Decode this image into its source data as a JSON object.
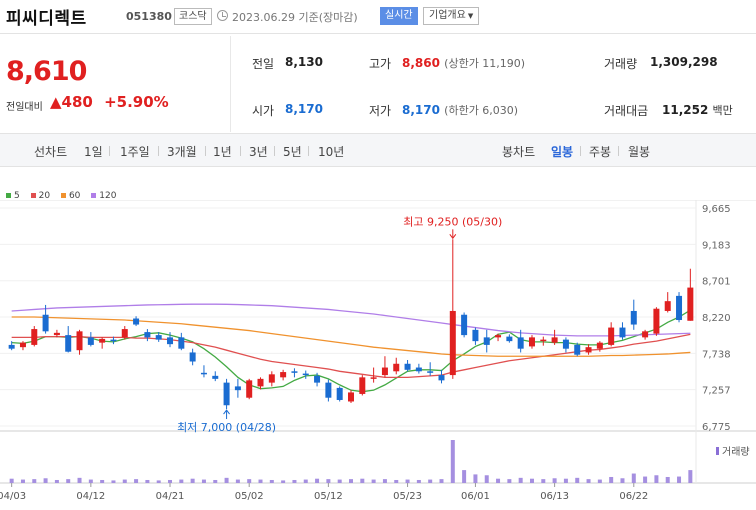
{
  "header": {
    "name": "피씨디렉트",
    "code": "051380",
    "market": "코스닥",
    "datetime": "2023.06.29 기준(장마감)",
    "realtime": "실시간",
    "company_info": "기업개요"
  },
  "price": {
    "current": "8,610",
    "change_label": "전일대비",
    "change_amount": "▲480",
    "change_pct": "+5.90%",
    "color_up": "#e02020",
    "color_down": "#1a6cd1"
  },
  "stats": {
    "prev_close": {
      "label": "전일",
      "value": "8,130"
    },
    "high": {
      "label": "고가",
      "value": "8,860",
      "sub": "(상한가 11,190)"
    },
    "volume": {
      "label": "거래량",
      "value": "1,309,298"
    },
    "open": {
      "label": "시가",
      "value": "8,170"
    },
    "low": {
      "label": "저가",
      "value": "8,170",
      "sub": "(하한가 6,030)"
    },
    "trade_value": {
      "label": "거래대금",
      "value": "11,252",
      "unit": "백만"
    }
  },
  "toolbar": {
    "line_chart": "선차트",
    "periods": [
      "1일",
      "1주일",
      "3개월",
      "1년",
      "3년",
      "5년",
      "10년"
    ],
    "candle_chart": "봉차트",
    "candle_types": [
      "일봉",
      "주봉",
      "월봉"
    ],
    "active_candle": "일봉"
  },
  "chart_data": {
    "type": "candlestick",
    "ma_legend": [
      {
        "name": "5",
        "color": "#44aa44"
      },
      {
        "name": "20",
        "color": "#e05050"
      },
      {
        "name": "60",
        "color": "#f0922e"
      },
      {
        "name": "120",
        "color": "#b07ee8"
      }
    ],
    "y_ticks": [
      "9,665",
      "9,183",
      "8,701",
      "8,220",
      "7,738",
      "7,257",
      "6,775"
    ],
    "ylim": [
      6775,
      9665
    ],
    "x_ticks": [
      "04/03",
      "04/12",
      "04/21",
      "05/02",
      "05/12",
      "05/23",
      "06/01",
      "06/13",
      "06/22"
    ],
    "high_annotation": "최고 9,250 (05/30)",
    "low_annotation": "최저 7,000 (04/28)",
    "volume_label": "거래량",
    "up_color": "#e02020",
    "down_color": "#1a6cd1",
    "candles": [
      {
        "date": "04/03",
        "o": 7850,
        "h": 7900,
        "l": 7780,
        "c": 7800
      },
      {
        "date": "04/04",
        "o": 7820,
        "h": 7900,
        "l": 7780,
        "c": 7880
      },
      {
        "date": "04/05",
        "o": 7850,
        "h": 8100,
        "l": 7830,
        "c": 8060
      },
      {
        "date": "04/06",
        "o": 8250,
        "h": 8380,
        "l": 8000,
        "c": 8030
      },
      {
        "date": "04/07",
        "o": 7980,
        "h": 8050,
        "l": 7950,
        "c": 8010
      },
      {
        "date": "04/10",
        "o": 7980,
        "h": 8100,
        "l": 7750,
        "c": 7760
      },
      {
        "date": "04/11",
        "o": 7780,
        "h": 8050,
        "l": 7720,
        "c": 8030
      },
      {
        "date": "04/12",
        "o": 7950,
        "h": 8020,
        "l": 7830,
        "c": 7850
      },
      {
        "date": "04/13",
        "o": 7880,
        "h": 7950,
        "l": 7800,
        "c": 7930
      },
      {
        "date": "04/14",
        "o": 7920,
        "h": 7960,
        "l": 7860,
        "c": 7900
      },
      {
        "date": "04/17",
        "o": 7950,
        "h": 8100,
        "l": 7920,
        "c": 8060
      },
      {
        "date": "04/18",
        "o": 8200,
        "h": 8230,
        "l": 8100,
        "c": 8120
      },
      {
        "date": "04/19",
        "o": 8020,
        "h": 8060,
        "l": 7900,
        "c": 7950
      },
      {
        "date": "04/20",
        "o": 7980,
        "h": 8020,
        "l": 7890,
        "c": 7920
      },
      {
        "date": "04/21",
        "o": 7950,
        "h": 8020,
        "l": 7820,
        "c": 7860
      },
      {
        "date": "04/24",
        "o": 7950,
        "h": 8010,
        "l": 7780,
        "c": 7800
      },
      {
        "date": "04/25",
        "o": 7750,
        "h": 7800,
        "l": 7580,
        "c": 7630
      },
      {
        "date": "04/26",
        "o": 7480,
        "h": 7580,
        "l": 7420,
        "c": 7460
      },
      {
        "date": "04/27",
        "o": 7440,
        "h": 7500,
        "l": 7370,
        "c": 7400
      },
      {
        "date": "04/28",
        "o": 7350,
        "h": 7400,
        "l": 7000,
        "c": 7050
      },
      {
        "date": "05/01",
        "o": 7300,
        "h": 7400,
        "l": 7150,
        "c": 7250
      },
      {
        "date": "05/02",
        "o": 7150,
        "h": 7400,
        "l": 7130,
        "c": 7380
      },
      {
        "date": "05/03",
        "o": 7300,
        "h": 7420,
        "l": 7260,
        "c": 7400
      },
      {
        "date": "05/04",
        "o": 7350,
        "h": 7500,
        "l": 7300,
        "c": 7460
      },
      {
        "date": "05/08",
        "o": 7420,
        "h": 7520,
        "l": 7380,
        "c": 7490
      },
      {
        "date": "05/09",
        "o": 7500,
        "h": 7540,
        "l": 7420,
        "c": 7480
      },
      {
        "date": "05/10",
        "o": 7470,
        "h": 7510,
        "l": 7400,
        "c": 7450
      },
      {
        "date": "05/11",
        "o": 7440,
        "h": 7480,
        "l": 7300,
        "c": 7350
      },
      {
        "date": "05/12",
        "o": 7350,
        "h": 7390,
        "l": 7100,
        "c": 7150
      },
      {
        "date": "05/15",
        "o": 7280,
        "h": 7300,
        "l": 7100,
        "c": 7120
      },
      {
        "date": "05/16",
        "o": 7100,
        "h": 7250,
        "l": 7080,
        "c": 7220
      },
      {
        "date": "05/17",
        "o": 7200,
        "h": 7450,
        "l": 7180,
        "c": 7420
      },
      {
        "date": "05/18",
        "o": 7400,
        "h": 7550,
        "l": 7350,
        "c": 7420
      },
      {
        "date": "05/19",
        "o": 7450,
        "h": 7700,
        "l": 7420,
        "c": 7550
      },
      {
        "date": "05/22",
        "o": 7500,
        "h": 7680,
        "l": 7460,
        "c": 7600
      },
      {
        "date": "05/23",
        "o": 7600,
        "h": 7650,
        "l": 7500,
        "c": 7520
      },
      {
        "date": "05/24",
        "o": 7550,
        "h": 7600,
        "l": 7470,
        "c": 7500
      },
      {
        "date": "05/25",
        "o": 7500,
        "h": 7620,
        "l": 7440,
        "c": 7480
      },
      {
        "date": "05/26",
        "o": 7450,
        "h": 7520,
        "l": 7340,
        "c": 7380
      },
      {
        "date": "05/30",
        "o": 7450,
        "h": 9250,
        "l": 7400,
        "c": 8300
      },
      {
        "date": "05/31",
        "o": 8250,
        "h": 8280,
        "l": 7950,
        "c": 7980
      },
      {
        "date": "06/01",
        "o": 8050,
        "h": 8080,
        "l": 7850,
        "c": 7900
      },
      {
        "date": "06/02",
        "o": 7950,
        "h": 8050,
        "l": 7750,
        "c": 7850
      },
      {
        "date": "06/05",
        "o": 7950,
        "h": 8000,
        "l": 7900,
        "c": 7980
      },
      {
        "date": "06/07",
        "o": 7960,
        "h": 7990,
        "l": 7880,
        "c": 7900
      },
      {
        "date": "06/08",
        "o": 7950,
        "h": 8050,
        "l": 7750,
        "c": 7800
      },
      {
        "date": "06/09",
        "o": 7830,
        "h": 7980,
        "l": 7800,
        "c": 7950
      },
      {
        "date": "06/12",
        "o": 7900,
        "h": 7960,
        "l": 7840,
        "c": 7920
      },
      {
        "date": "06/13",
        "o": 7880,
        "h": 8050,
        "l": 7850,
        "c": 7950
      },
      {
        "date": "06/14",
        "o": 7920,
        "h": 7950,
        "l": 7750,
        "c": 7800
      },
      {
        "date": "06/15",
        "o": 7850,
        "h": 7880,
        "l": 7700,
        "c": 7720
      },
      {
        "date": "06/16",
        "o": 7750,
        "h": 7860,
        "l": 7720,
        "c": 7820
      },
      {
        "date": "06/19",
        "o": 7800,
        "h": 7900,
        "l": 7760,
        "c": 7880
      },
      {
        "date": "06/20",
        "o": 7850,
        "h": 8150,
        "l": 7830,
        "c": 8080
      },
      {
        "date": "06/21",
        "o": 8080,
        "h": 8150,
        "l": 7920,
        "c": 7950
      },
      {
        "date": "06/22",
        "o": 8300,
        "h": 8450,
        "l": 8050,
        "c": 8120
      },
      {
        "date": "06/23",
        "o": 7950,
        "h": 8050,
        "l": 7920,
        "c": 8030
      },
      {
        "date": "06/26",
        "o": 8000,
        "h": 8350,
        "l": 7970,
        "c": 8330
      },
      {
        "date": "06/27",
        "o": 8300,
        "h": 8550,
        "l": 8280,
        "c": 8430
      },
      {
        "date": "06/28",
        "o": 8500,
        "h": 8550,
        "l": 8150,
        "c": 8180
      },
      {
        "date": "06/29",
        "o": 8170,
        "h": 8860,
        "l": 8170,
        "c": 8610
      }
    ],
    "volumes": [
      10,
      8,
      9,
      11,
      7,
      9,
      12,
      8,
      7,
      6,
      8,
      9,
      7,
      6,
      7,
      8,
      10,
      8,
      7,
      12,
      8,
      9,
      8,
      7,
      6,
      7,
      8,
      10,
      9,
      8,
      9,
      10,
      8,
      9,
      7,
      8,
      7,
      8,
      9,
      100,
      30,
      20,
      18,
      10,
      9,
      12,
      10,
      9,
      11,
      10,
      12,
      9,
      8,
      14,
      11,
      22,
      15,
      18,
      14,
      15,
      30
    ],
    "ma_series": {
      "ma5": [
        7880,
        7870,
        7900,
        7960,
        7960,
        7950,
        7960,
        7940,
        7900,
        7890,
        7930,
        7960,
        8000,
        8010,
        7980,
        7940,
        7890,
        7800,
        7690,
        7560,
        7420,
        7320,
        7270,
        7280,
        7300,
        7380,
        7440,
        7450,
        7400,
        7320,
        7250,
        7230,
        7250,
        7320,
        7410,
        7500,
        7520,
        7520,
        7510,
        7640,
        7730,
        7830,
        7890,
        7990,
        8020,
        7920,
        7890,
        7890,
        7880,
        7880,
        7860,
        7850,
        7850,
        7880,
        7910,
        7960,
        8010,
        8060,
        8150,
        8220,
        8310
      ],
      "ma20": [
        7950,
        7950,
        7950,
        7960,
        7960,
        7960,
        7960,
        7950,
        7950,
        7950,
        7950,
        7940,
        7940,
        7930,
        7920,
        7900,
        7880,
        7850,
        7820,
        7780,
        7740,
        7700,
        7660,
        7630,
        7610,
        7590,
        7570,
        7550,
        7530,
        7500,
        7480,
        7460,
        7440,
        7420,
        7420,
        7420,
        7430,
        7440,
        7450,
        7490,
        7520,
        7550,
        7580,
        7610,
        7640,
        7660,
        7680,
        7700,
        7720,
        7740,
        7760,
        7780,
        7790,
        7810,
        7830,
        7860,
        7880,
        7900,
        7930,
        7960,
        7990
      ],
      "ma60": [
        8220,
        8220,
        8220,
        8215,
        8210,
        8205,
        8200,
        8195,
        8190,
        8185,
        8180,
        8170,
        8160,
        8150,
        8140,
        8130,
        8115,
        8100,
        8085,
        8070,
        8055,
        8040,
        8020,
        8000,
        7980,
        7960,
        7940,
        7920,
        7900,
        7880,
        7860,
        7840,
        7820,
        7805,
        7790,
        7775,
        7760,
        7745,
        7730,
        7720,
        7715,
        7710,
        7705,
        7700,
        7700,
        7700,
        7700,
        7700,
        7700,
        7700,
        7700,
        7700,
        7705,
        7710,
        7710,
        7715,
        7720,
        7725,
        7730,
        7740,
        7750
      ],
      "ma120": [
        8300,
        8310,
        8320,
        8330,
        8340,
        8345,
        8350,
        8355,
        8360,
        8365,
        8370,
        8375,
        8380,
        8382,
        8385,
        8388,
        8390,
        8390,
        8390,
        8388,
        8385,
        8380,
        8375,
        8370,
        8360,
        8350,
        8340,
        8330,
        8320,
        8305,
        8290,
        8275,
        8260,
        8240,
        8220,
        8200,
        8180,
        8160,
        8140,
        8120,
        8100,
        8080,
        8060,
        8040,
        8025,
        8010,
        8000,
        7990,
        7980,
        7975,
        7970,
        7970,
        7970,
        7970,
        7975,
        7980,
        7985,
        7990,
        7995,
        8000,
        8005
      ]
    }
  }
}
